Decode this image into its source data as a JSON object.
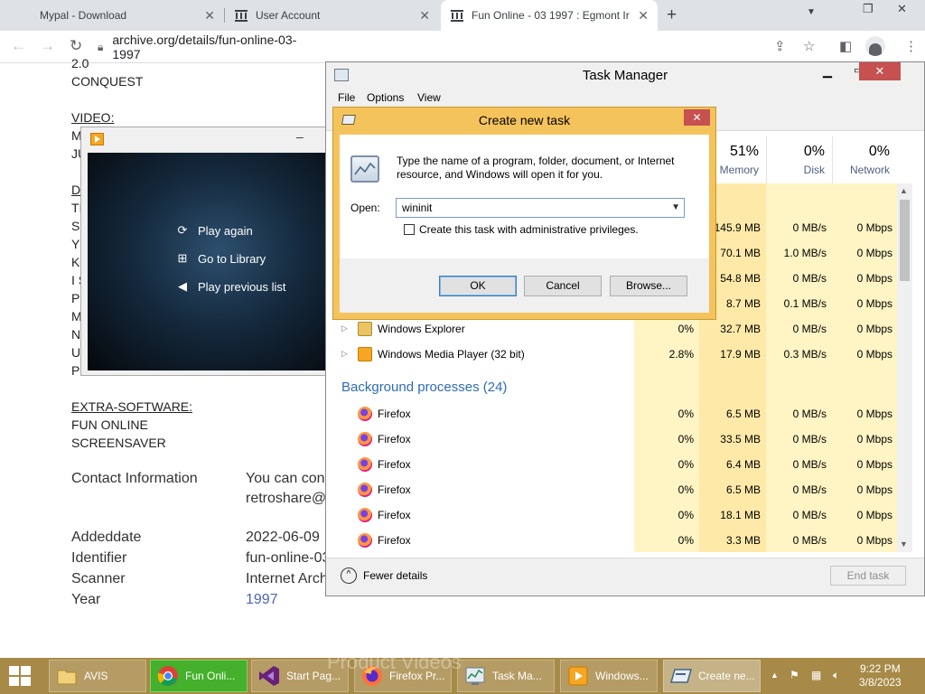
{
  "browser": {
    "tabs": [
      {
        "title": "Mypal - Download",
        "close": "✕"
      },
      {
        "title": "User Account",
        "close": "✕"
      },
      {
        "title": "Fun Online - 03 1997 : Egmont Ir",
        "close": "✕"
      }
    ],
    "new_tab": "+",
    "url": "archive.org/details/fun-online-03-1997"
  },
  "page": {
    "version_fragment": "2.0",
    "conquest": "CONQUEST",
    "video_heading": "VIDEO:",
    "letters": [
      "M",
      "JU",
      "D",
      "TI",
      "S",
      "Y",
      "K",
      "I S",
      "P",
      "M",
      "N",
      "U",
      "P"
    ],
    "extra_heading": "EXTRA-SOFTWARE:",
    "extra_1": "FUN ONLINE",
    "extra_2": "SCREENSAVER",
    "contact_label": "Contact Information",
    "contact_1": "You can con",
    "contact_2": "retroshare@",
    "addeddate_label": "Addeddate",
    "addeddate_value": "2022-06-09",
    "identifier_label": "Identifier",
    "identifier_value": "fun-online-03",
    "scanner_label": "Scanner",
    "scanner_value": "Internet Arch",
    "year_label": "Year",
    "year_value": "1997"
  },
  "player": {
    "minimize": "–",
    "menu": [
      {
        "label": "Play again",
        "icon": "replay-icon"
      },
      {
        "label": "Go to Library",
        "icon": "library-icon"
      },
      {
        "label": "Play previous list",
        "icon": "back-arrow-icon"
      }
    ]
  },
  "task_manager": {
    "title": "Task Manager",
    "menu": [
      "File",
      "Options",
      "View"
    ],
    "columns": [
      {
        "pct": "51%",
        "label": "Memory"
      },
      {
        "pct": "0%",
        "label": "Disk"
      },
      {
        "pct": "0%",
        "label": "Network"
      }
    ],
    "apps": [
      {
        "name": "",
        "cpu": "",
        "mem": "145.9 MB",
        "disk": "0 MB/s",
        "net": "0 Mbps"
      },
      {
        "name": "",
        "cpu": "",
        "mem": "70.1 MB",
        "disk": "1.0 MB/s",
        "net": "0 Mbps"
      },
      {
        "name": "",
        "cpu": "",
        "mem": "54.8 MB",
        "disk": "0 MB/s",
        "net": "0 Mbps"
      },
      {
        "name": "",
        "cpu": "",
        "mem": "8.7 MB",
        "disk": "0.1 MB/s",
        "net": "0 Mbps"
      },
      {
        "name": "Windows Explorer",
        "cpu": "0%",
        "mem": "32.7 MB",
        "disk": "0 MB/s",
        "net": "0 Mbps"
      },
      {
        "name": "Windows Media Player (32 bit)",
        "cpu": "2.8%",
        "mem": "17.9 MB",
        "disk": "0.3 MB/s",
        "net": "0 Mbps"
      }
    ],
    "background_heading": "Background processes (24)",
    "background": [
      {
        "name": "Firefox",
        "cpu": "0%",
        "mem": "6.5 MB",
        "disk": "0 MB/s",
        "net": "0 Mbps"
      },
      {
        "name": "Firefox",
        "cpu": "0%",
        "mem": "33.5 MB",
        "disk": "0 MB/s",
        "net": "0 Mbps"
      },
      {
        "name": "Firefox",
        "cpu": "0%",
        "mem": "6.4 MB",
        "disk": "0 MB/s",
        "net": "0 Mbps"
      },
      {
        "name": "Firefox",
        "cpu": "0%",
        "mem": "6.5 MB",
        "disk": "0 MB/s",
        "net": "0 Mbps"
      },
      {
        "name": "Firefox",
        "cpu": "0%",
        "mem": "18.1 MB",
        "disk": "0 MB/s",
        "net": "0 Mbps"
      },
      {
        "name": "Firefox",
        "cpu": "0%",
        "mem": "3.3 MB",
        "disk": "0 MB/s",
        "net": "0 Mbps"
      }
    ],
    "fewer_details": "Fewer details",
    "end_task": "End task"
  },
  "dialog": {
    "title": "Create new task",
    "close": "✕",
    "message": "Type the name of a program, folder, document, or Internet resource, and Windows will open it for you.",
    "open_label": "Open:",
    "open_value": "wininit",
    "admin_label": "Create this task with administrative privileges.",
    "ok": "OK",
    "cancel": "Cancel",
    "browse": "Browse..."
  },
  "taskbar": {
    "items": [
      {
        "label": "AVIS",
        "icon": "folder-icon"
      },
      {
        "label": "Fun Onli...",
        "icon": "chrome-icon"
      },
      {
        "label": "Start Pag...",
        "icon": "visual-studio-icon"
      },
      {
        "label": "Firefox Pr...",
        "icon": "firefox-icon"
      },
      {
        "label": "Task Ma...",
        "icon": "task-manager-icon"
      },
      {
        "label": "Windows...",
        "icon": "media-player-icon"
      },
      {
        "label": "Create ne...",
        "icon": "run-dialog-icon"
      }
    ],
    "watermark": "Product Videos",
    "time": "9:22 PM",
    "date": "3/8/2023"
  },
  "colors": {
    "taskbar": "#a78a47",
    "dialog_frame": "#f5c35b",
    "active_taskbar_item": "#44b02b",
    "link": "#4b64b8"
  }
}
